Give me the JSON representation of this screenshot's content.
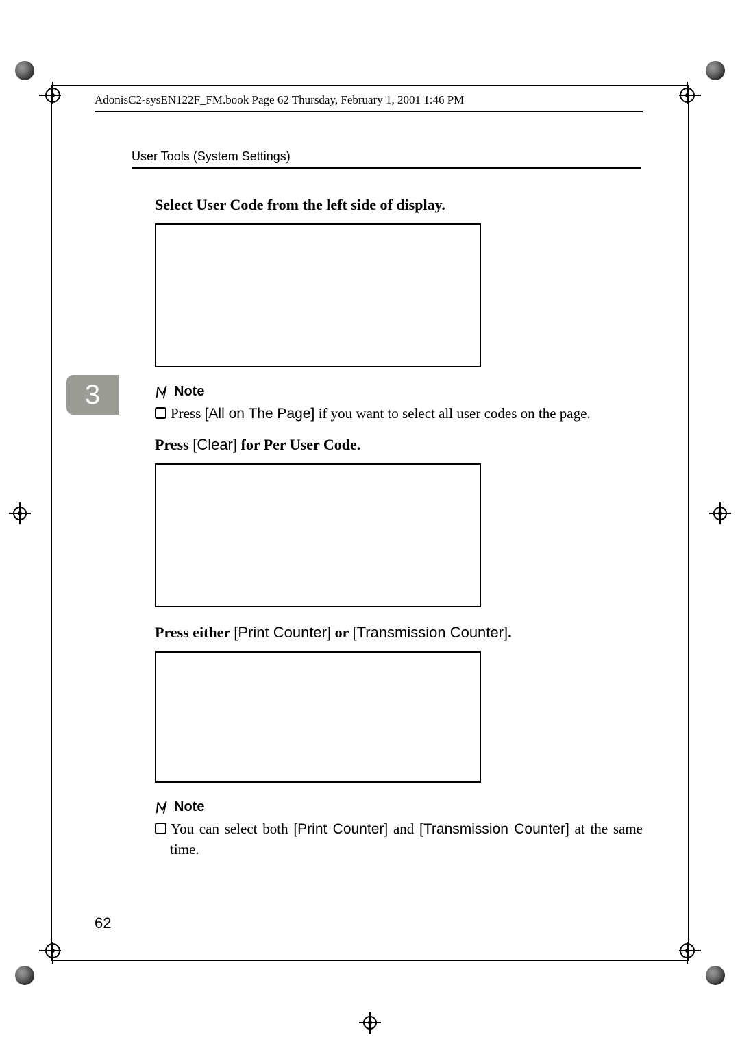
{
  "header": {
    "crop_info": "AdonisC2-sysEN122F_FM.book  Page 62  Thursday, February 1, 2001  1:46 PM",
    "section": "User Tools (System Settings)"
  },
  "tab": {
    "number": "3"
  },
  "steps": {
    "select_heading": "Select User Code from the left side of display.",
    "note1_label": "Note",
    "note1_prefix": "Press ",
    "note1_button": "[All on The Page]",
    "note1_suffix": " if you want to select all user codes on the page.",
    "press_clear_prefix": "Press ",
    "press_clear_button": "[Clear]",
    "press_clear_suffix": " for Per User Code.",
    "press_either_prefix": "Press either ",
    "press_either_b1": "[Print Counter]",
    "press_either_mid": " or ",
    "press_either_b2": "[Transmission Counter]",
    "press_either_suffix": ".",
    "note2_label": "Note",
    "note2_prefix": "You can select both ",
    "note2_b1": "[Print Counter]",
    "note2_mid": " and ",
    "note2_b2": "[Transmission Counter]",
    "note2_suffix": " at the same time."
  },
  "page_number": "62"
}
